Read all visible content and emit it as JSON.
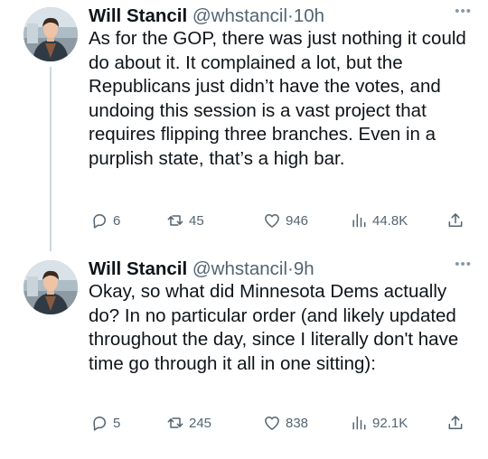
{
  "tweets": [
    {
      "author_name": "Will Stancil",
      "handle": "@whstancil",
      "separator": "·",
      "time": "10h",
      "text": "As for the GOP, there was just nothing it could do about it. It complained a lot, but the Republicans just didn’t have the votes, and undoing this session is a vast project that requires flipping three branches. Even in a purplish state, that’s a high bar.",
      "replies": "6",
      "reposts": "45",
      "likes": "946",
      "views": "44.8K",
      "icons": [
        "reply-icon",
        "repost-icon",
        "like-icon",
        "views-icon",
        "share-icon",
        "more-icon"
      ]
    },
    {
      "author_name": "Will Stancil",
      "handle": "@whstancil",
      "separator": "·",
      "time": "9h",
      "text": "Okay, so what did Minnesota Dems actually do? In no particular order (and likely updated throughout the day, since I literally don't have time go through it all in one sitting):",
      "replies": "5",
      "reposts": "245",
      "likes": "838",
      "views": "92.1K",
      "icons": [
        "reply-icon",
        "repost-icon",
        "like-icon",
        "views-icon",
        "share-icon",
        "more-icon"
      ]
    }
  ],
  "colors": {
    "text": "#0f1419",
    "secondary": "#536471",
    "thread_line": "#cfd9de"
  }
}
